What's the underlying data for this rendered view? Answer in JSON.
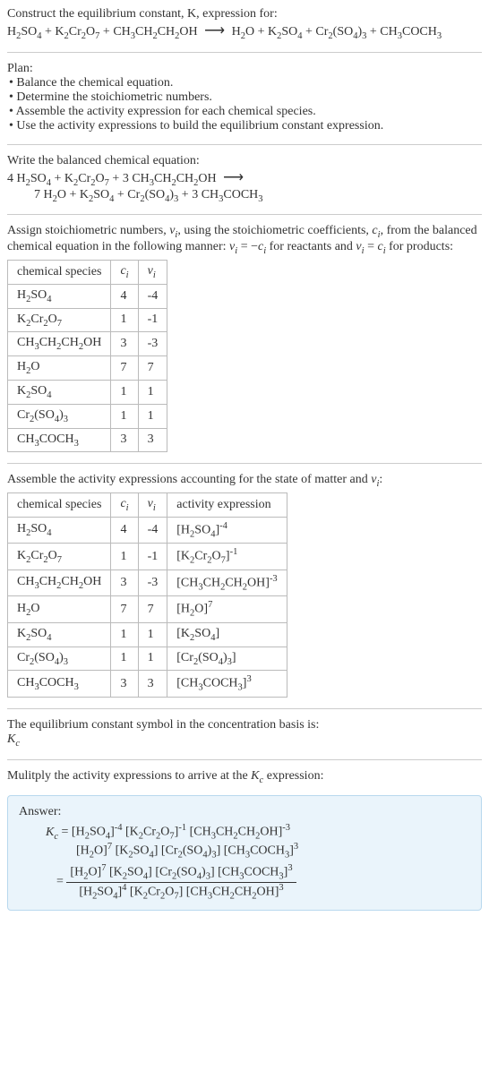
{
  "intro": {
    "line1": "Construct the equilibrium constant, K, expression for:",
    "equation_lhs": "H₂SO₄ + K₂Cr₂O₇ + CH₃CH₂CH₂OH",
    "equation_rhs": "H₂O + K₂SO₄ + Cr₂(SO₄)₃ + CH₃COCH₃"
  },
  "plan": {
    "heading": "Plan:",
    "items": [
      "• Balance the chemical equation.",
      "• Determine the stoichiometric numbers.",
      "• Assemble the activity expression for each chemical species.",
      "• Use the activity expressions to build the equilibrium constant expression."
    ]
  },
  "balanced": {
    "heading": "Write the balanced chemical equation:",
    "lhs": "4 H₂SO₄ + K₂Cr₂O₇ + 3 CH₃CH₂CH₂OH",
    "rhs": "7 H₂O + K₂SO₄ + Cr₂(SO₄)₃ + 3 CH₃COCH₃"
  },
  "stoich": {
    "text1": "Assign stoichiometric numbers, νᵢ, using the stoichiometric coefficients, cᵢ, from the balanced chemical equation in the following manner: νᵢ = −cᵢ for reactants and νᵢ = cᵢ for products:",
    "headers": [
      "chemical species",
      "cᵢ",
      "νᵢ"
    ],
    "rows": [
      {
        "sp": "H₂SO₄",
        "c": "4",
        "v": "-4"
      },
      {
        "sp": "K₂Cr₂O₇",
        "c": "1",
        "v": "-1"
      },
      {
        "sp": "CH₃CH₂CH₂OH",
        "c": "3",
        "v": "-3"
      },
      {
        "sp": "H₂O",
        "c": "7",
        "v": "7"
      },
      {
        "sp": "K₂SO₄",
        "c": "1",
        "v": "1"
      },
      {
        "sp": "Cr₂(SO₄)₃",
        "c": "1",
        "v": "1"
      },
      {
        "sp": "CH₃COCH₃",
        "c": "3",
        "v": "3"
      }
    ]
  },
  "activity": {
    "heading": "Assemble the activity expressions accounting for the state of matter and νᵢ:",
    "headers": [
      "chemical species",
      "cᵢ",
      "νᵢ",
      "activity expression"
    ],
    "rows": [
      {
        "sp": "H₂SO₄",
        "c": "4",
        "v": "-4",
        "a": "[H₂SO₄]⁻⁴"
      },
      {
        "sp": "K₂Cr₂O₇",
        "c": "1",
        "v": "-1",
        "a": "[K₂Cr₂O₇]⁻¹"
      },
      {
        "sp": "CH₃CH₂CH₂OH",
        "c": "3",
        "v": "-3",
        "a": "[CH₃CH₂CH₂OH]⁻³"
      },
      {
        "sp": "H₂O",
        "c": "7",
        "v": "7",
        "a": "[H₂O]⁷"
      },
      {
        "sp": "K₂SO₄",
        "c": "1",
        "v": "1",
        "a": "[K₂SO₄]"
      },
      {
        "sp": "Cr₂(SO₄)₃",
        "c": "1",
        "v": "1",
        "a": "[Cr₂(SO₄)₃]"
      },
      {
        "sp": "CH₃COCH₃",
        "c": "3",
        "v": "3",
        "a": "[CH₃COCH₃]³"
      }
    ]
  },
  "symbol": {
    "line1": "The equilibrium constant symbol in the concentration basis is:",
    "line2": "K_c"
  },
  "multiply": {
    "heading": "Mulitply the activity expressions to arrive at the K_c expression:"
  },
  "answer": {
    "label": "Answer:",
    "kc": "K_c = ",
    "line1": "[H₂SO₄]⁻⁴ [K₂Cr₂O₇]⁻¹ [CH₃CH₂CH₂OH]⁻³",
    "line2": "[H₂O]⁷ [K₂SO₄] [Cr₂(SO₄)₃] [CH₃COCH₃]³",
    "eq": " = ",
    "num": "[H₂O]⁷ [K₂SO₄] [Cr₂(SO₄)₃] [CH₃COCH₃]³",
    "den": "[H₂SO₄]⁴ [K₂Cr₂O₇] [CH₃CH₂CH₂OH]³"
  }
}
